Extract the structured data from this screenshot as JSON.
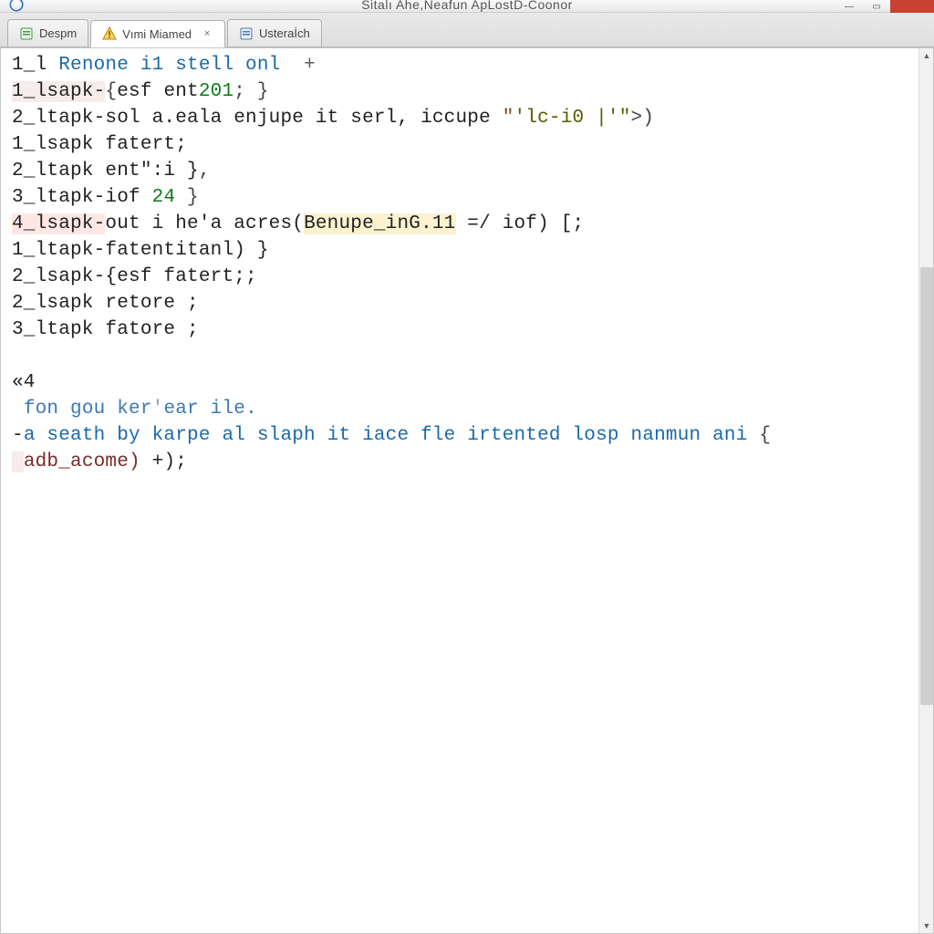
{
  "window": {
    "title": "Sitalı Ahe,Neafun ApLostD-Coonor"
  },
  "tabs": [
    {
      "label": "Despm",
      "icon": "file-icon-green",
      "active": false,
      "closable": false
    },
    {
      "label": "Vımi Miamed",
      "icon": "warning-icon",
      "active": true,
      "closable": true
    },
    {
      "label": "Usteraİch",
      "icon": "file-icon-blue",
      "active": false,
      "closable": false
    }
  ],
  "code_lines": [
    {
      "prefix": "1_l ",
      "tokens": [
        {
          "t": "Renone i1 stell onl  ",
          "cls": "kw2"
        },
        {
          "t": "+",
          "cls": "sym"
        }
      ],
      "hl": "none"
    },
    {
      "prefix": "1_lsapk-",
      "hl": "soft",
      "tokens": [
        {
          "t": "{",
          "cls": "punc"
        },
        {
          "t": "esf ent",
          "cls": ""
        },
        {
          "t": "201",
          "cls": "num"
        },
        {
          "t": "; }",
          "cls": "punc"
        }
      ]
    },
    {
      "prefix": "2_ltapk-",
      "tokens": [
        {
          "t": "sol a.eala enjupe it serl, iccupe ",
          "cls": ""
        },
        {
          "t": "\"",
          "cls": "br"
        },
        {
          "t": "'lc-i0 |'\"",
          "cls": "str"
        },
        {
          "t": ">",
          "cls": "punc"
        },
        {
          "t": ")",
          "cls": "punc"
        }
      ]
    },
    {
      "prefix": "1_lsapk ",
      "tokens": [
        {
          "t": "fatert;",
          "cls": ""
        }
      ]
    },
    {
      "prefix": "2_ltapk ",
      "tokens": [
        {
          "t": "ent\":i }",
          "cls": ""
        },
        {
          "t": ",",
          "cls": "punc"
        }
      ]
    },
    {
      "prefix": "3_ltapk-",
      "tokens": [
        {
          "t": "iof ",
          "cls": ""
        },
        {
          "t": "24",
          "cls": "num"
        },
        {
          "t": " }",
          "cls": "punc"
        }
      ]
    },
    {
      "prefix": "4_lsapk-",
      "hl": "hl",
      "tokens": [
        {
          "t": "out i he'a ",
          "cls": ""
        },
        {
          "t": "acres(",
          "cls": ""
        },
        {
          "t": "Benupe_inG.11",
          "cls": "hl-yel inline-block"
        },
        {
          "t": " =/ iof) [;",
          "cls": ""
        }
      ]
    },
    {
      "prefix": "1_ltapk-",
      "tokens": [
        {
          "t": "fatentitanl) }",
          "cls": ""
        }
      ]
    },
    {
      "prefix": "2_lsapk-",
      "tokens": [
        {
          "t": "{esf fatert;;",
          "cls": ""
        }
      ]
    },
    {
      "prefix": "2_lsapk ",
      "tokens": [
        {
          "t": "retore ;",
          "cls": ""
        }
      ]
    },
    {
      "prefix": "3_ltapk ",
      "tokens": [
        {
          "t": "fatore ;",
          "cls": ""
        }
      ]
    },
    {
      "blank": true
    },
    {
      "prefix": "«4",
      "tokens": []
    },
    {
      "prefix": " ",
      "tokens": [
        {
          "t": "fon gou ker",
          "cls": "lblue"
        },
        {
          "t": "'",
          "cls": "dim"
        },
        {
          "t": "ear ile.",
          "cls": "lblue"
        }
      ]
    },
    {
      "prefix": "-",
      "tokens": [
        {
          "t": "a seath by karpe al slaph it iace fle irtented losp nanmun ani ",
          "cls": "kw2"
        },
        {
          "t": "{",
          "cls": "punc"
        }
      ]
    },
    {
      "prefix": " ",
      "hl": "soft",
      "tokens": [
        {
          "t": "adb_acome)",
          "cls": "fn"
        },
        {
          "t": " +);",
          "cls": ""
        }
      ]
    }
  ]
}
